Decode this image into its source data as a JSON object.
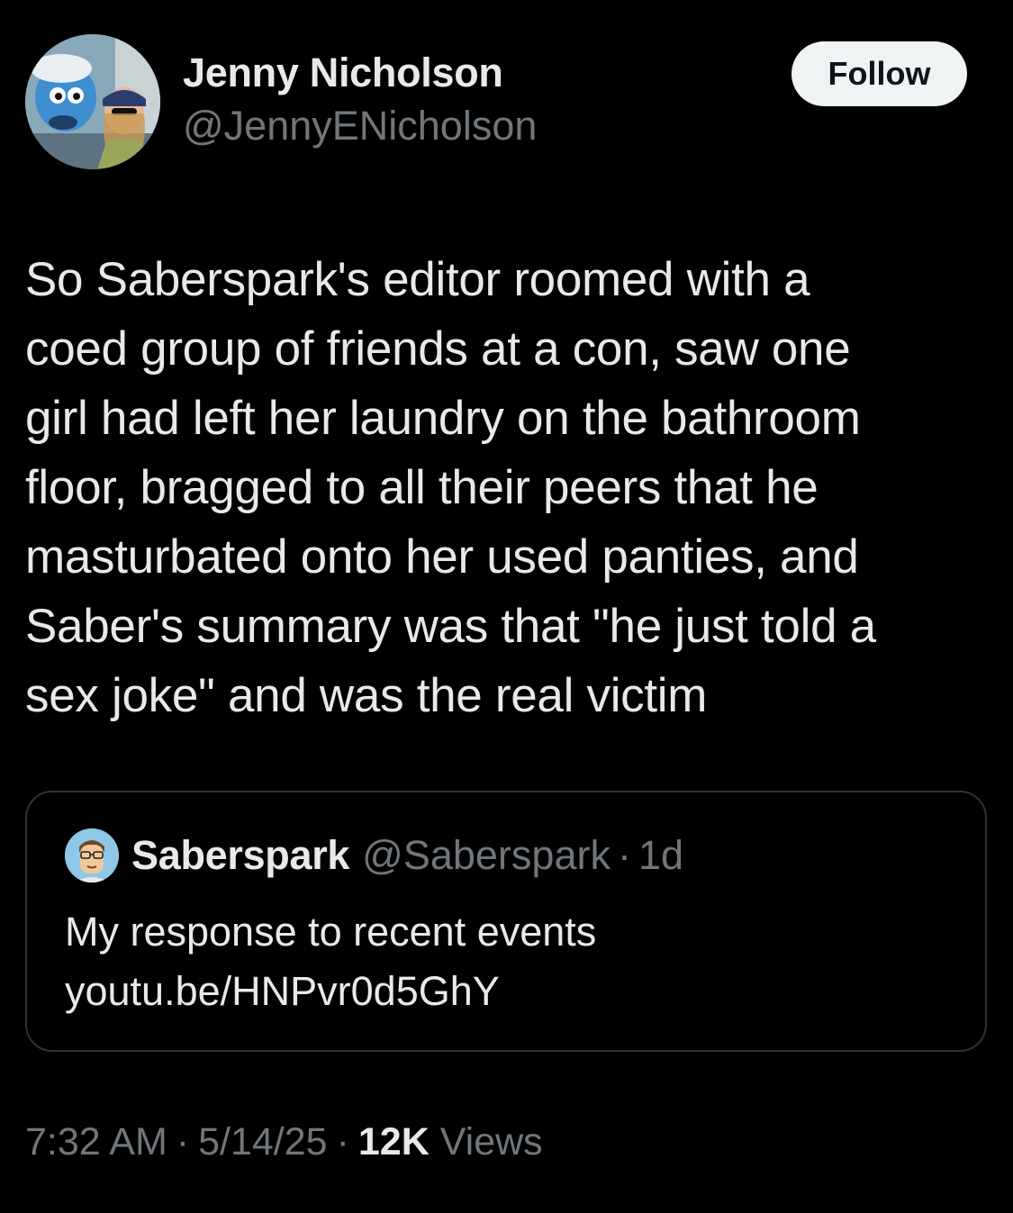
{
  "author": {
    "display_name": "Jenny Nicholson",
    "handle": "@JennyENicholson",
    "avatar_icon": "profile-photo-avatar"
  },
  "follow_button": {
    "label": "Follow"
  },
  "tweet": {
    "text": "So Saberspark's editor roomed with a\ncoed group of friends at a con, saw one\ngirl had left her laundry on the bathroom\nfloor, bragged to all their peers that he\nmasturbated onto her used panties, and\nSaber's summary was that \"he just told a\nsex joke\" and was the real victim"
  },
  "quoted_tweet": {
    "display_name": "Saberspark",
    "handle": "@Saberspark",
    "separator": "·",
    "time": "1d",
    "text": "My response to recent events",
    "link": "youtu.be/HNPvr0d5GhY",
    "avatar_icon": "cartoon-avatar"
  },
  "meta": {
    "time": "7:32 AM",
    "separator": "·",
    "date": "5/14/25",
    "views_count": "12K",
    "views_label": "Views"
  },
  "colors": {
    "background": "#000000",
    "primary_text": "#e7e9ea",
    "secondary_text": "#71767b",
    "border": "#2f3336",
    "button_bg": "#eff3f4"
  }
}
